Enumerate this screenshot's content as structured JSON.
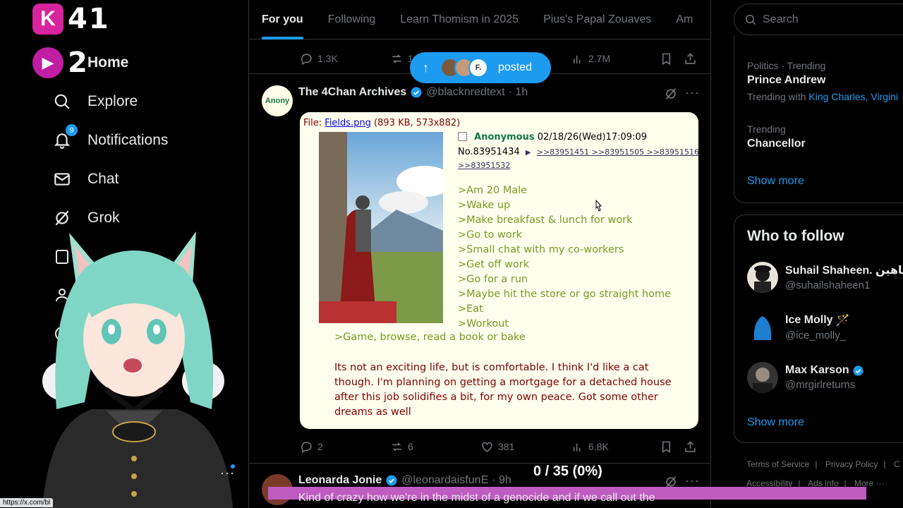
{
  "overlay": {
    "counter1": "41",
    "counter1_icon": "K",
    "counter2": "2"
  },
  "nav": {
    "home": "Home",
    "explore": "Explore",
    "notifications": "Notifications",
    "notifications_badge": "9",
    "chat": "Chat",
    "grok": "Grok"
  },
  "status_url": "https://x.com/bl",
  "tabs": [
    "For you",
    "Following",
    "Learn Thomism in 2025",
    "Pius's Papal Zouaves",
    "Am"
  ],
  "top_actions": {
    "replies": "1.3K",
    "reposts": "1",
    "views": "2.7M"
  },
  "posted_pill": {
    "label": "posted",
    "avatar3_letter": "F."
  },
  "tweet1": {
    "name": "The 4Chan Archives",
    "handle": "@blacknredtext",
    "time": "· 1h",
    "avatar_text": "Anony",
    "replies": "2",
    "reposts": "6",
    "likes": "381",
    "views": "6.8K"
  },
  "chan": {
    "file_prefix": "File:",
    "file_name": "Fields.png",
    "file_info": "(893 KB, 573x882)",
    "author": "Anonymous",
    "date": "02/18/26(Wed)17:09:09",
    "post_no": "No.83951434",
    "arrow": "▶",
    "replies_line1": ">>83951451 >>83951505 >>83951516",
    "replies_line2": ">>83951532",
    "greentext": [
      ">Am 20 Male",
      ">Wake up",
      ">Make breakfast & lunch for work",
      ">Go to work",
      ">Small chat with my co-workers",
      ">Get off work",
      ">Go for a run",
      ">Maybe hit the store or go straight home",
      ">Eat",
      ">Workout"
    ],
    "greentext_last": ">Game, browse, read a book or bake",
    "body": "Its not an exciting life, but is comfortable. I think I'd like a cat though. I'm planning on getting a mortgage for a detached house after this job solidifies a bit, for my own peace. Got some other dreams as well"
  },
  "tweet2": {
    "name": "Leonarda Jonie",
    "handle": "@leonardaisfunE",
    "time": "· 9h",
    "text": "Kind of crazy how we're in the midst of a genocide and if we call out the"
  },
  "progress": {
    "text": "0 / 35 (0%)",
    "fraction": 0
  },
  "search": {
    "placeholder": "Search"
  },
  "trends": [
    {
      "category": "Politics · Trending",
      "title": "Prince Andrew",
      "with_label": "Trending with",
      "with_links": "King Charles, Virgini"
    },
    {
      "category": "Trending",
      "title": "Chancellor"
    }
  ],
  "show_more": "Show more",
  "who_to_follow": {
    "title": "Who to follow",
    "accounts": [
      {
        "name": "Suhail Shaheen. شاهين",
        "handle": "@suhailshaheen1"
      },
      {
        "name": "Ice Molly",
        "emoji": "🪄",
        "handle": "@ice_molly_"
      },
      {
        "name": "Max Karson",
        "handle": "@mrgirlreturns"
      }
    ],
    "show_more": "Show more"
  },
  "footer": {
    "row1": [
      "Terms of Service",
      "Privacy Policy",
      "C"
    ],
    "row2": [
      "Accessibility",
      "Ads info",
      "More ···"
    ]
  },
  "colors": {
    "accent": "#1d9bf0",
    "background": "#000000",
    "overlay_pink": "#d6239e",
    "subtitle_bar": "#c05cc0"
  }
}
